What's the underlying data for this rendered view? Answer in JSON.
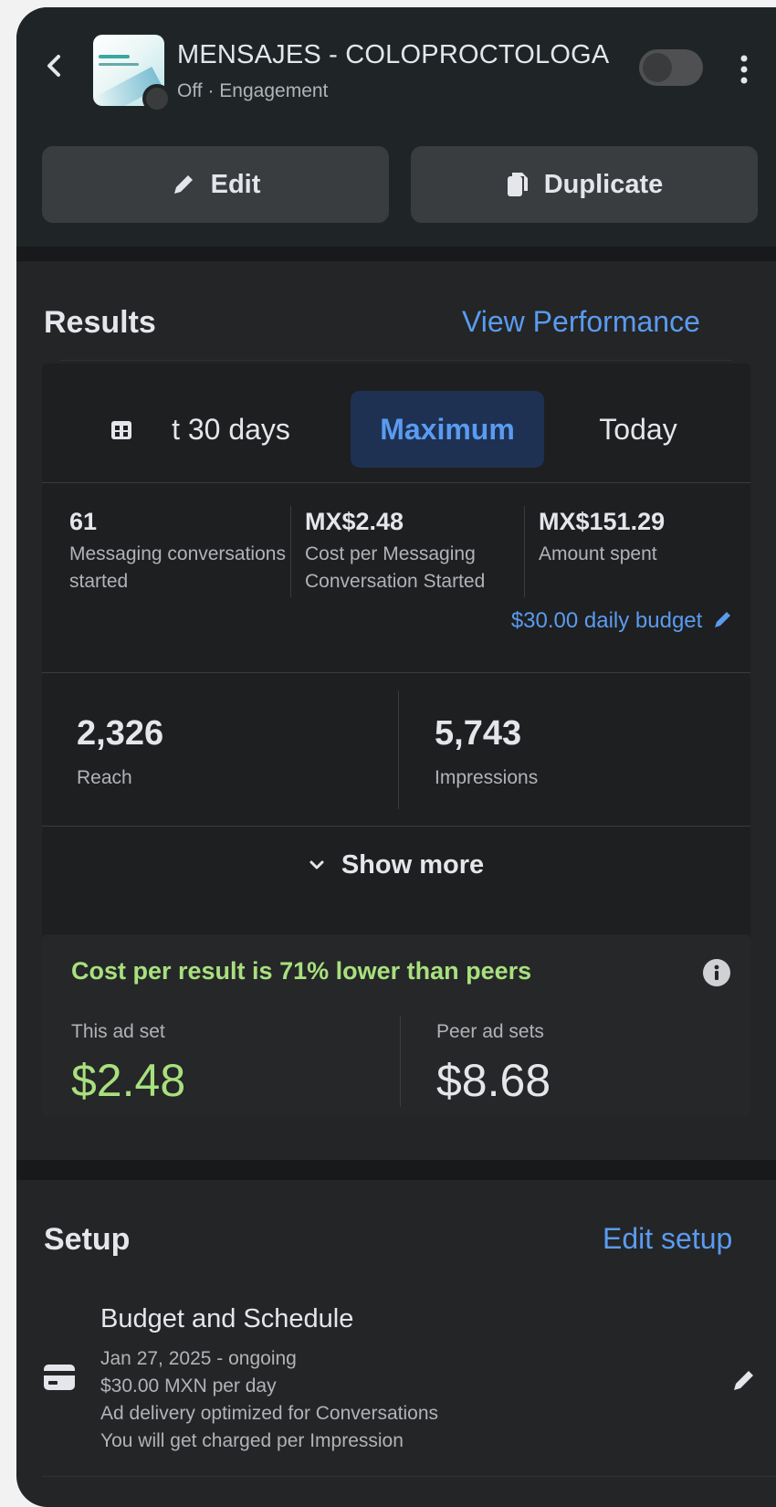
{
  "header": {
    "title": "MENSAJES - COLOPROCTOLOGA",
    "status": "Off",
    "objective": "Engagement",
    "edit_label": "Edit",
    "duplicate_label": "Duplicate"
  },
  "results": {
    "title": "Results",
    "view_performance": "View Performance",
    "tabs": [
      {
        "label": "t 30 days"
      },
      {
        "label": "Maximum"
      },
      {
        "label": "Today"
      }
    ],
    "metrics": [
      {
        "value": "61",
        "label": "Messaging conversations started"
      },
      {
        "value": "MX$2.48",
        "label": "Cost per Messaging Conversation Started"
      },
      {
        "value": "MX$151.29",
        "label": "Amount spent"
      }
    ],
    "budget_link": "$30.00 daily budget",
    "reach": {
      "value": "2,326",
      "label": "Reach"
    },
    "impressions": {
      "value": "5,743",
      "label": "Impressions"
    },
    "show_more": "Show more",
    "peer": {
      "headline": "Cost per result is 71% lower than peers",
      "this_label": "This ad set",
      "this_value": "$2.48",
      "peer_label": "Peer ad sets",
      "peer_value": "$8.68"
    }
  },
  "setup": {
    "title": "Setup",
    "edit_setup": "Edit setup",
    "budget_schedule": {
      "title": "Budget and Schedule",
      "lines": [
        "Jan 27, 2025 - ongoing",
        "$30.00 MXN per day",
        "Ad delivery optimized for Conversations",
        "You will get charged per Impression"
      ]
    }
  },
  "colors": {
    "accent_blue": "#5a9bf0",
    "positive_green": "#a8e07e",
    "background": "#242526"
  },
  "icons": [
    "back-chevron-icon",
    "more-vertical-icon",
    "pencil-icon",
    "copy-icon",
    "calendar-grid-icon",
    "chevron-down-icon",
    "info-icon",
    "credit-card-icon"
  ]
}
